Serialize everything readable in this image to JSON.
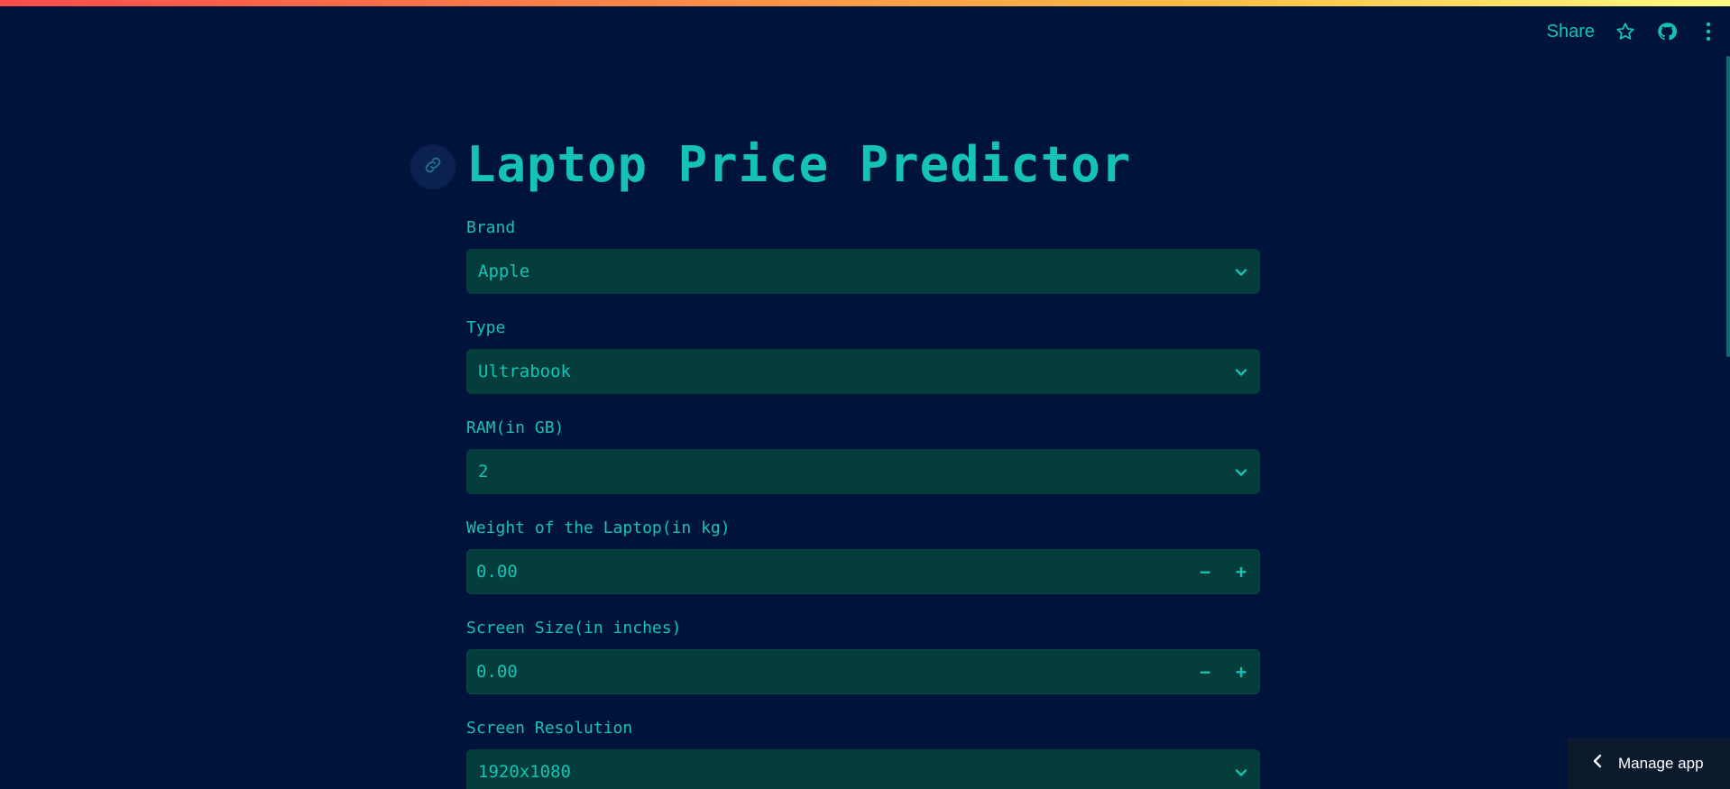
{
  "header": {
    "share_label": "Share"
  },
  "title": "Laptop Price Predictor",
  "fields": {
    "brand": {
      "label": "Brand",
      "value": "Apple"
    },
    "type": {
      "label": "Type",
      "value": "Ultrabook"
    },
    "ram": {
      "label": "RAM(in GB)",
      "value": "2"
    },
    "weight": {
      "label": "Weight of the Laptop(in kg)",
      "value": "0.00",
      "minus": "−",
      "plus": "+"
    },
    "screen_size": {
      "label": "Screen Size(in inches)",
      "value": "0.00",
      "minus": "−",
      "plus": "+"
    },
    "resolution": {
      "label": "Screen Resolution",
      "value": "1920x1080"
    }
  },
  "manage_app": {
    "label": "Manage app"
  },
  "colors": {
    "background": "#00133a",
    "accent": "#14c3b3",
    "input_bg": "#053d3c"
  },
  "icons": [
    "star-icon",
    "github-icon",
    "more-vertical-icon",
    "link-icon",
    "chevron-down-icon",
    "chevron-left-icon"
  ]
}
